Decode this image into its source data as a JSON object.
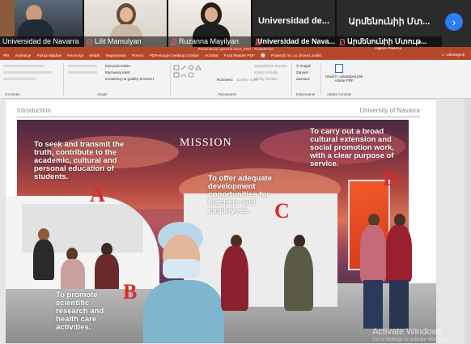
{
  "video_call": {
    "tiles": [
      {
        "name": "Universidad de Navarra",
        "muted": false
      },
      {
        "name": "Lilit Mamulyan",
        "muted": true
      },
      {
        "name": "Ruzanna Mayilyan",
        "muted": true
      },
      {
        "name": "Universidad de Nava...",
        "muted": true,
        "center_text": "Universidad de..."
      },
      {
        "name": "Արմենունիի Մտութ...",
        "muted": true,
        "center_text": "Արմենունիի Մտ..."
      }
    ],
    "next_icon": "chevron-right-icon"
  },
  "powerpoint": {
    "title_bar": "Presentacion general 2223_ENG - PowerPoint",
    "search_hint": "Powiedz mi, co chcesz zrobić",
    "user": "Higinio Paterna",
    "share_label": "Udostępnij",
    "menu": [
      "Plik",
      "Animacje",
      "Pokaz slajdów",
      "Recenzja",
      "Widok",
      "Nagrywanie",
      "Pomoc",
      "PDFescape Desktop Creator",
      "Acrobat",
      "Foxit Reader PDF"
    ],
    "ribbon_groups": [
      "Czcionka",
      "Akapit",
      "Rysowanie",
      "Edytowanie",
      "Adobe Acrobat"
    ],
    "ribbon_items": {
      "kierunek": "Kierunek tekstu",
      "wyrownaj": "Wyrównaj tekst",
      "smartart": "Konwertuj na grafikę SmartArt",
      "rozmiesc": "Rozmieść",
      "style": "Szybkie style",
      "wypelnienie": "Wypełnienie kształtu",
      "kontur": "Kontur kształtu",
      "efekty": "Efekty kształtu",
      "znajdz": "Znajdź",
      "zamien": "Zamień",
      "zaznacz": "Zaznacz",
      "adobe": "Utwórz i udostępnij plik Adobe PDF"
    }
  },
  "slide": {
    "header_left": "Introduction",
    "header_right": "University of Navarra",
    "mission_title": "MISSION",
    "point_a": "To seek and transmit the truth, contribute to the academic, cultural and personal education of students.",
    "point_b": "To promote scientific research and health care activities.",
    "point_c": "To offer adequate development opportunities for teachers and employees.",
    "point_d": "To carry out a broad cultural extension and social promotion work, with a clear purpose of service.",
    "letters": {
      "a": "A",
      "b": "B",
      "c": "C",
      "d": "D"
    }
  },
  "watermark": {
    "title": "Activate Windows",
    "subtitle": "Go to Settings to activate Windows."
  },
  "colors": {
    "ribbon_accent": "#b7472a",
    "slide_letter": "#d92a2a",
    "next_button": "#2d7df6"
  }
}
